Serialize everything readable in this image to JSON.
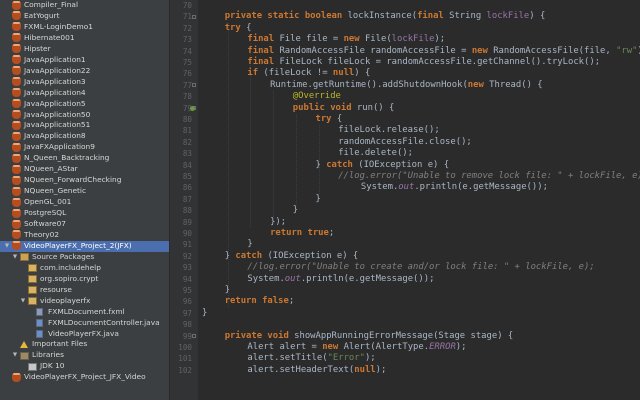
{
  "tree": {
    "items": [
      {
        "label": "Compiler_Final",
        "icon": "project-icon"
      },
      {
        "label": "EatYogurt",
        "icon": "project-icon"
      },
      {
        "label": "FXML-LoginDemo1",
        "icon": "project-icon"
      },
      {
        "label": "Hibernate001",
        "icon": "project-icon"
      },
      {
        "label": "Hipster",
        "icon": "project-icon"
      },
      {
        "label": "JavaApplication1",
        "icon": "project-icon"
      },
      {
        "label": "JavaApplication22",
        "icon": "project-icon"
      },
      {
        "label": "JavaApplication3",
        "icon": "project-icon"
      },
      {
        "label": "JavaApplication4",
        "icon": "project-icon"
      },
      {
        "label": "JavaApplication5",
        "icon": "project-icon"
      },
      {
        "label": "JavaApplication50",
        "icon": "project-icon"
      },
      {
        "label": "JavaApplication51",
        "icon": "project-icon"
      },
      {
        "label": "JavaApplication8",
        "icon": "project-icon"
      },
      {
        "label": "JavaFXApplication9",
        "icon": "project-icon"
      },
      {
        "label": "N_Queen_Backtracking",
        "icon": "project-icon"
      },
      {
        "label": "NQueen_AStar",
        "icon": "project-icon"
      },
      {
        "label": "NQueen_ForwardChecking",
        "icon": "project-icon"
      },
      {
        "label": "NQueen_Genetic",
        "icon": "project-icon"
      },
      {
        "label": "OpenGL_001",
        "icon": "project-icon"
      },
      {
        "label": "PostgreSQL",
        "icon": "project-icon"
      },
      {
        "label": "Software07",
        "icon": "project-icon"
      },
      {
        "label": "Theory02",
        "icon": "project-icon"
      },
      {
        "label": "VideoPlayerFX_Project_2(JFX)",
        "icon": "project-icon",
        "selected": true,
        "expanded": true
      },
      {
        "label": "Source Packages",
        "icon": "source-packages-icon",
        "level": 1,
        "expanded": true
      },
      {
        "label": "com.includehelp",
        "icon": "package-icon",
        "level": 2
      },
      {
        "label": "org.sopiro.crypt",
        "icon": "package-icon",
        "level": 2
      },
      {
        "label": "resourse",
        "icon": "package-icon",
        "level": 2
      },
      {
        "label": "videoplayerfx",
        "icon": "package-icon",
        "level": 2,
        "expanded": true
      },
      {
        "label": "FXMLDocument.fxml",
        "icon": "fxml-file-icon",
        "level": 3
      },
      {
        "label": "FXMLDocumentController.java",
        "icon": "java-file-icon",
        "level": 3
      },
      {
        "label": "VideoPlayerFX.java",
        "icon": "java-file-icon",
        "level": 3
      },
      {
        "label": "Important Files",
        "icon": "important-files-icon",
        "level": 1
      },
      {
        "label": "Libraries",
        "icon": "libraries-icon",
        "level": 1,
        "expanded": true
      },
      {
        "label": "JDK 10",
        "icon": "jdk-icon",
        "level": 2
      },
      {
        "label": "VideoPlayerFX_Project_JFX_Video",
        "icon": "project-icon",
        "partial": true
      }
    ]
  },
  "editor": {
    "first_line": 70,
    "lines": [
      {
        "n": 70,
        "indent": 0,
        "tokens": []
      },
      {
        "n": 71,
        "indent": 1,
        "tokens": [
          [
            "kw",
            "private static boolean "
          ],
          [
            "var",
            "lockInstance("
          ],
          [
            "kw",
            "final "
          ],
          [
            "var",
            "String "
          ],
          [
            "fld",
            "lockFile"
          ],
          [
            "var",
            ") {"
          ]
        ]
      },
      {
        "n": 72,
        "indent": 1,
        "tokens": [
          [
            "kw",
            "try "
          ],
          [
            "var",
            "{"
          ]
        ]
      },
      {
        "n": 73,
        "indent": 2,
        "tokens": [
          [
            "kw",
            "final "
          ],
          [
            "var",
            "File file = "
          ],
          [
            "kw",
            "new "
          ],
          [
            "var",
            "File("
          ],
          [
            "fld",
            "lockFile"
          ],
          [
            "var",
            ");"
          ]
        ]
      },
      {
        "n": 74,
        "indent": 2,
        "tokens": [
          [
            "kw",
            "final "
          ],
          [
            "var",
            "RandomAccessFile randomAccessFile = "
          ],
          [
            "kw",
            "new "
          ],
          [
            "var",
            "RandomAccessFile(file, "
          ],
          [
            "str",
            "\"rw\""
          ],
          [
            "var",
            ");"
          ]
        ]
      },
      {
        "n": 75,
        "indent": 2,
        "tokens": [
          [
            "kw",
            "final "
          ],
          [
            "var",
            "FileLock fileLock = randomAccessFile.getChannel().tryLock();"
          ]
        ]
      },
      {
        "n": 76,
        "indent": 2,
        "tokens": [
          [
            "kw",
            "if "
          ],
          [
            "var",
            "(fileLock != "
          ],
          [
            "kw",
            "null"
          ],
          [
            "var",
            ") {"
          ]
        ]
      },
      {
        "n": 77,
        "indent": 3,
        "tokens": [
          [
            "var",
            "Runtime."
          ],
          [
            "var",
            "getRuntime().addShutdownHook("
          ],
          [
            "kw",
            "new "
          ],
          [
            "var",
            "Thread() {"
          ]
        ]
      },
      {
        "n": 78,
        "indent": 4,
        "tokens": [
          [
            "ann",
            "@Override"
          ]
        ]
      },
      {
        "n": 79,
        "indent": 4,
        "tokens": [
          [
            "kw",
            "public void "
          ],
          [
            "var",
            "run() {"
          ]
        ]
      },
      {
        "n": 80,
        "indent": 5,
        "tokens": [
          [
            "kw",
            "try "
          ],
          [
            "var",
            "{"
          ]
        ]
      },
      {
        "n": 81,
        "indent": 6,
        "tokens": [
          [
            "var",
            "fileLock.release();"
          ]
        ]
      },
      {
        "n": 82,
        "indent": 6,
        "tokens": [
          [
            "var",
            "randomAccessFile.close();"
          ]
        ]
      },
      {
        "n": 83,
        "indent": 6,
        "tokens": [
          [
            "var",
            "file.delete();"
          ]
        ]
      },
      {
        "n": 84,
        "indent": 5,
        "tokens": [
          [
            "var",
            "} "
          ],
          [
            "kw",
            "catch "
          ],
          [
            "var",
            "(IOException e) {"
          ]
        ]
      },
      {
        "n": 85,
        "indent": 6,
        "tokens": [
          [
            "cmt",
            "//log.error(\"Unable to remove lock file: \" + lockFile, e);"
          ]
        ]
      },
      {
        "n": 86,
        "indent": 7,
        "tokens": [
          [
            "var",
            "System."
          ],
          [
            "cst",
            "out"
          ],
          [
            "var",
            ".println(e.getMessage());"
          ]
        ]
      },
      {
        "n": 87,
        "indent": 5,
        "tokens": [
          [
            "var",
            "}"
          ]
        ]
      },
      {
        "n": 88,
        "indent": 4,
        "tokens": [
          [
            "var",
            "}"
          ]
        ]
      },
      {
        "n": 89,
        "indent": 3,
        "tokens": [
          [
            "var",
            "});"
          ]
        ]
      },
      {
        "n": 90,
        "indent": 3,
        "tokens": [
          [
            "kw",
            "return true"
          ],
          [
            "var",
            ";"
          ]
        ]
      },
      {
        "n": 91,
        "indent": 2,
        "tokens": [
          [
            "var",
            "}"
          ]
        ]
      },
      {
        "n": 92,
        "indent": 1,
        "tokens": [
          [
            "var",
            "} "
          ],
          [
            "kw",
            "catch "
          ],
          [
            "var",
            "(IOException e) {"
          ]
        ]
      },
      {
        "n": 93,
        "indent": 2,
        "tokens": [
          [
            "cmt",
            "//log.error(\"Unable to create and/or lock file: \" + lockFile, e);"
          ]
        ]
      },
      {
        "n": 94,
        "indent": 2,
        "tokens": [
          [
            "var",
            "System."
          ],
          [
            "cst",
            "out"
          ],
          [
            "var",
            ".println(e.getMessage());"
          ]
        ]
      },
      {
        "n": 95,
        "indent": 1,
        "tokens": [
          [
            "var",
            "}"
          ]
        ]
      },
      {
        "n": 96,
        "indent": 1,
        "tokens": [
          [
            "kw",
            "return false"
          ],
          [
            "var",
            ";"
          ]
        ]
      },
      {
        "n": 97,
        "indent": 0,
        "tokens": [
          [
            "var",
            "}"
          ]
        ]
      },
      {
        "n": 98,
        "indent": 0,
        "tokens": []
      },
      {
        "n": 99,
        "indent": 1,
        "tokens": [
          [
            "kw",
            "private void "
          ],
          [
            "var",
            "showAppRunningErrorMessage(Stage stage) {"
          ]
        ]
      },
      {
        "n": 100,
        "indent": 2,
        "tokens": [
          [
            "var",
            "Alert alert = "
          ],
          [
            "kw",
            "new "
          ],
          [
            "var",
            "Alert(AlertType."
          ],
          [
            "cst",
            "ERROR"
          ],
          [
            "var",
            ");"
          ]
        ]
      },
      {
        "n": 101,
        "indent": 2,
        "tokens": [
          [
            "var",
            "alert.setTitle("
          ],
          [
            "str",
            "\"Error\""
          ],
          [
            "var",
            ");"
          ]
        ]
      },
      {
        "n": 102,
        "indent": 2,
        "tokens": [
          [
            "var",
            "alert.setHeaderText("
          ],
          [
            "kw",
            "null"
          ],
          [
            "var",
            ");"
          ]
        ]
      }
    ]
  }
}
